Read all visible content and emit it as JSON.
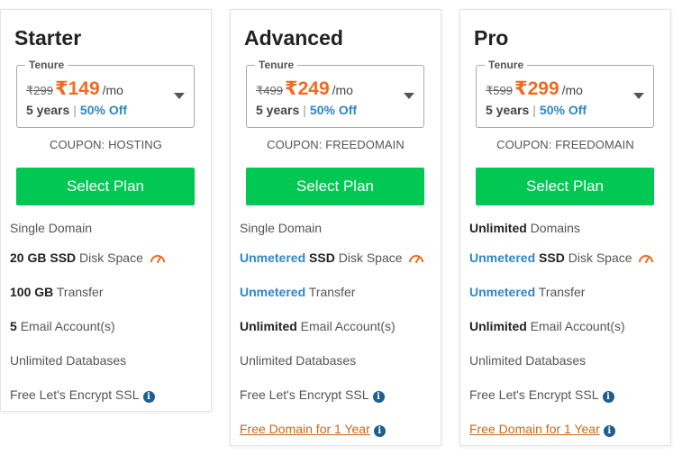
{
  "plans": [
    {
      "name": "Starter",
      "tenure_label": "Tenure",
      "old_price": "₹299",
      "new_price": "₹149",
      "per": "/mo",
      "term": "5 years",
      "discount": "50% Off",
      "coupon": "COUPON: HOSTING",
      "cta": "Select Plan",
      "features": {
        "domains": {
          "text": "Single Domain"
        },
        "disk": {
          "value": "20 GB",
          "ssd": "SSD",
          "text": "Disk Space"
        },
        "transfer": {
          "value": "100 GB",
          "text": "Transfer"
        },
        "email": {
          "value": "5",
          "text": "Email Account(s)"
        },
        "databases": {
          "text": "Unlimited Databases"
        },
        "ssl": {
          "text": "Free Let's Encrypt SSL"
        }
      }
    },
    {
      "name": "Advanced",
      "tenure_label": "Tenure",
      "old_price": "₹499",
      "new_price": "₹249",
      "per": "/mo",
      "term": "5 years",
      "discount": "50% Off",
      "coupon": "COUPON: FREEDOMAIN",
      "cta": "Select Plan",
      "features": {
        "domains": {
          "text": "Single Domain"
        },
        "disk": {
          "value": "Unmetered",
          "ssd": "SSD",
          "text": "Disk Space"
        },
        "transfer": {
          "value": "Unmetered",
          "text": "Transfer"
        },
        "email": {
          "value": "Unlimited",
          "text": "Email Account(s)"
        },
        "databases": {
          "text": "Unlimited Databases"
        },
        "ssl": {
          "text": "Free Let's Encrypt SSL"
        },
        "free_domain": {
          "text": "Free Domain for 1 Year"
        }
      }
    },
    {
      "name": "Pro",
      "tenure_label": "Tenure",
      "old_price": "₹599",
      "new_price": "₹299",
      "per": "/mo",
      "term": "5 years",
      "discount": "50% Off",
      "coupon": "COUPON: FREEDOMAIN",
      "cta": "Select Plan",
      "features": {
        "domains": {
          "value": "Unlimited",
          "text": "Domains"
        },
        "disk": {
          "value": "Unmetered",
          "ssd": "SSD",
          "text": "Disk Space"
        },
        "transfer": {
          "value": "Unmetered",
          "text": "Transfer"
        },
        "email": {
          "value": "Unlimited",
          "text": "Email Account(s)"
        },
        "databases": {
          "text": "Unlimited Databases"
        },
        "ssl": {
          "text": "Free Let's Encrypt SSL"
        },
        "free_domain": {
          "text": "Free Domain for 1 Year"
        }
      }
    }
  ],
  "icons": {
    "info": "info-circle-icon",
    "disk_speed": "speedometer-icon",
    "dropdown": "caret-down-icon"
  },
  "colors": {
    "price": "#f26a21",
    "discount": "#2f86c9",
    "button": "#00c853",
    "link": "#c56a1f",
    "info_icon": "#1f5f8f"
  }
}
